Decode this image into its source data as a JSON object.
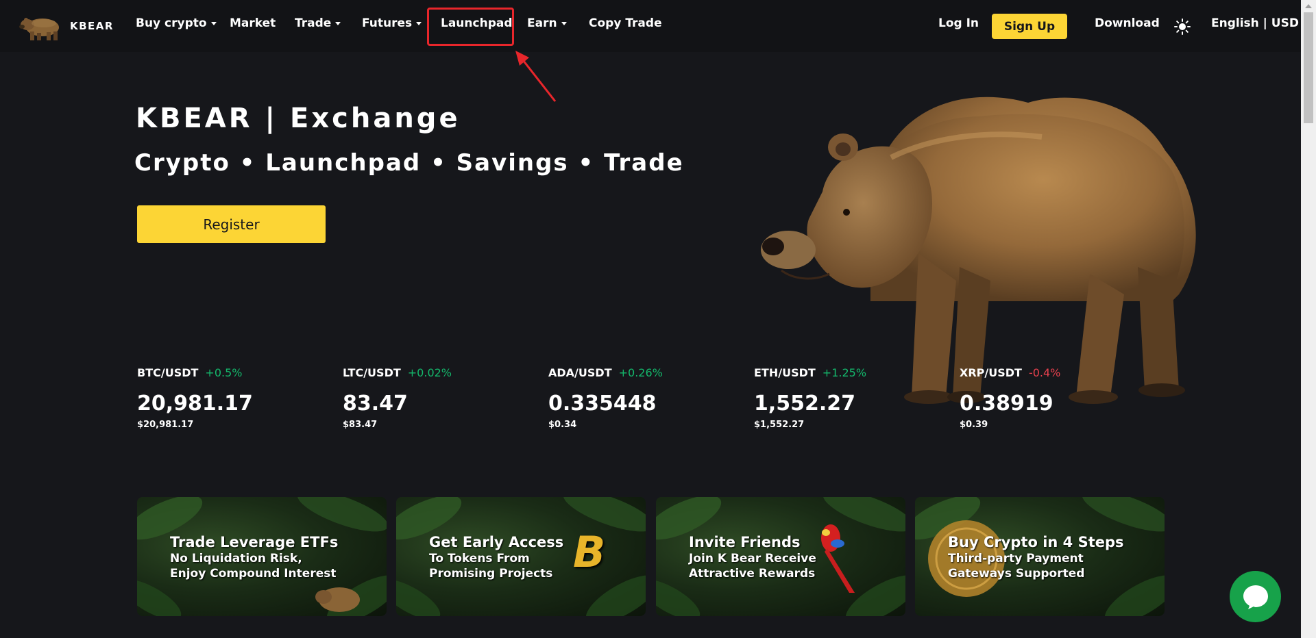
{
  "nav": {
    "logo_text": "KBEAR",
    "items": [
      {
        "label": "Buy crypto",
        "dropdown": true
      },
      {
        "label": "Market",
        "dropdown": false
      },
      {
        "label": "Trade",
        "dropdown": true
      },
      {
        "label": "Futures",
        "dropdown": true
      },
      {
        "label": "Launchpad",
        "dropdown": false,
        "highlighted": true
      },
      {
        "label": "Earn",
        "dropdown": true
      },
      {
        "label": "Copy Trade",
        "dropdown": false
      }
    ],
    "login": "Log In",
    "signup": "Sign Up",
    "download": "Download",
    "theme_icon": "sun-icon",
    "language": "English | USD"
  },
  "hero": {
    "title": "KBEAR | Exchange",
    "subtitle": "Crypto • Launchpad • Savings • Trade",
    "register": "Register"
  },
  "tickers": [
    {
      "pair": "BTC/USDT",
      "change": "+0.5%",
      "direction": "up",
      "price": "20,981.17",
      "usd": "$20,981.17"
    },
    {
      "pair": "LTC/USDT",
      "change": "+0.02%",
      "direction": "up",
      "price": "83.47",
      "usd": "$83.47"
    },
    {
      "pair": "ADA/USDT",
      "change": "+0.26%",
      "direction": "up",
      "price": "0.335448",
      "usd": "$0.34"
    },
    {
      "pair": "ETH/USDT",
      "change": "+1.25%",
      "direction": "up",
      "price": "1,552.27",
      "usd": "$1,552.27"
    },
    {
      "pair": "XRP/USDT",
      "change": "-0.4%",
      "direction": "down",
      "price": "0.38919",
      "usd": "$0.39"
    }
  ],
  "banners": [
    {
      "title": "Trade Leverage ETFs",
      "line1": "No Liquidation Risk,",
      "line2": "Enjoy Compound  Interest"
    },
    {
      "title": "Get Early Access",
      "line1": "To Tokens From",
      "line2": "Promising Projects",
      "badge": "B"
    },
    {
      "title": "Invite Friends",
      "line1": "Join K Bear Receive",
      "line2": "Attractive Rewards"
    },
    {
      "title": "Buy Crypto in 4 Steps",
      "line1": "Third-party Payment",
      "line2": "Gateways Supported"
    }
  ],
  "colors": {
    "accent": "#fcd535",
    "background": "#16171b",
    "up": "#14b86c",
    "down": "#e8414e",
    "annotation": "#e8262b",
    "chat": "#17a24a"
  },
  "icons": {
    "chat": "chat-bubble-icon"
  }
}
